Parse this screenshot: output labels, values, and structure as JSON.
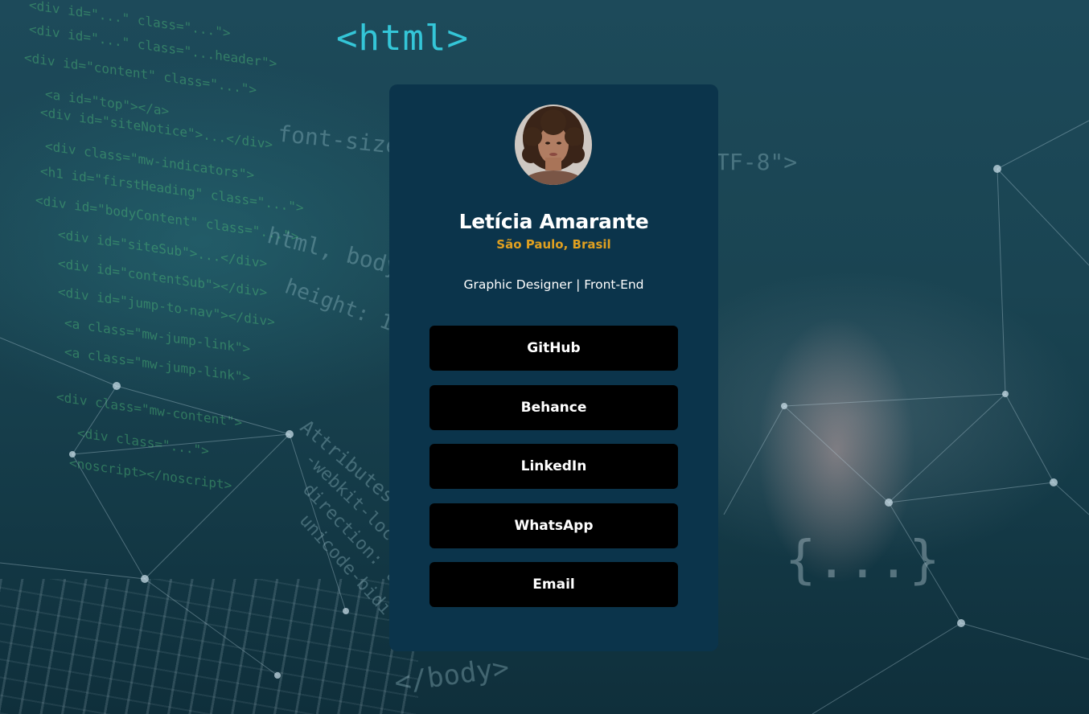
{
  "background": {
    "html_tag_text": "<html>",
    "braces_text": "{...}",
    "colors": {
      "base": "#1a4452",
      "accent_code": "#34c6d8"
    }
  },
  "profile": {
    "name": "Letícia Amarante",
    "location": "São Paulo, Brasil",
    "role": "Graphic Designer | Front-End",
    "avatar_icon": "profile-photo"
  },
  "links": [
    {
      "label": "GitHub"
    },
    {
      "label": "Behance"
    },
    {
      "label": "LinkedIn"
    },
    {
      "label": "WhatsApp"
    },
    {
      "label": "Email"
    }
  ],
  "colors": {
    "card": "#0b344b",
    "button": "#000000",
    "location_accent": "#e0a020",
    "text": "#ffffff"
  }
}
